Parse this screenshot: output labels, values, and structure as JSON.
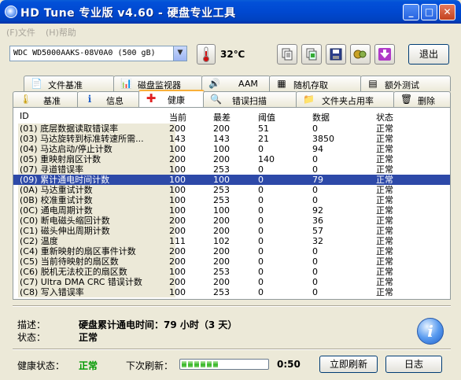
{
  "window": {
    "title": "HD Tune 专业版 v4.60 - 硬盘专业工具"
  },
  "menu": [
    "(F)文件",
    "(H)帮助"
  ],
  "toolbar": {
    "drive": "WDC WD5000AAKS-08V0A0 (500 gB)",
    "temperature": "32℃",
    "exit_label": "退出"
  },
  "tabs_top": [
    {
      "label": "文件基准",
      "icon": "file-benchmark-icon"
    },
    {
      "label": "磁盘监视器",
      "icon": "disk-monitor-icon"
    },
    {
      "label": "AAM",
      "icon": "speaker-icon"
    },
    {
      "label": "随机存取",
      "icon": "random-access-icon"
    },
    {
      "label": "额外测试",
      "icon": "extra-tests-icon"
    }
  ],
  "tabs_bottom": [
    {
      "label": "基准",
      "icon": "benchmark-icon"
    },
    {
      "label": "信息",
      "icon": "info-icon"
    },
    {
      "label": "健康",
      "icon": "health-icon",
      "active": true
    },
    {
      "label": "错误扫描",
      "icon": "error-scan-icon"
    },
    {
      "label": "文件夹占用率",
      "icon": "folder-usage-icon"
    },
    {
      "label": "删除",
      "icon": "erase-icon"
    }
  ],
  "table": {
    "headers": {
      "id": "ID",
      "current": "当前",
      "worst": "最差",
      "threshold": "阈值",
      "data": "数据",
      "status": "状态"
    },
    "rows": [
      {
        "id": "(01) 底层数据读取错误率",
        "current": "200",
        "worst": "200",
        "threshold": "51",
        "data": "0",
        "status": "正常"
      },
      {
        "id": "(03) 马达旋转到标准转速所需...",
        "current": "143",
        "worst": "143",
        "threshold": "21",
        "data": "3850",
        "status": "正常"
      },
      {
        "id": "(04) 马达启动/停止计数",
        "current": "100",
        "worst": "100",
        "threshold": "0",
        "data": "94",
        "status": "正常"
      },
      {
        "id": "(05) 重映射扇区计数",
        "current": "200",
        "worst": "200",
        "threshold": "140",
        "data": "0",
        "status": "正常"
      },
      {
        "id": "(07) 寻道错误率",
        "current": "100",
        "worst": "253",
        "threshold": "0",
        "data": "0",
        "status": "正常"
      },
      {
        "id": "(09) 累计通电时间计数",
        "current": "100",
        "worst": "100",
        "threshold": "0",
        "data": "79",
        "status": "正常",
        "selected": true
      },
      {
        "id": "(0A) 马达重试计数",
        "current": "100",
        "worst": "253",
        "threshold": "0",
        "data": "0",
        "status": "正常"
      },
      {
        "id": "(0B) 校准重试计数",
        "current": "100",
        "worst": "253",
        "threshold": "0",
        "data": "0",
        "status": "正常"
      },
      {
        "id": "(0C) 通电周期计数",
        "current": "100",
        "worst": "100",
        "threshold": "0",
        "data": "92",
        "status": "正常"
      },
      {
        "id": "(C0) 断电磁头缩回计数",
        "current": "200",
        "worst": "200",
        "threshold": "0",
        "data": "36",
        "status": "正常"
      },
      {
        "id": "(C1) 磁头伸出周期计数",
        "current": "200",
        "worst": "200",
        "threshold": "0",
        "data": "57",
        "status": "正常"
      },
      {
        "id": "(C2) 温度",
        "current": "111",
        "worst": "102",
        "threshold": "0",
        "data": "32",
        "status": "正常"
      },
      {
        "id": "(C4) 重新映射的扇区事件计数",
        "current": "200",
        "worst": "200",
        "threshold": "0",
        "data": "0",
        "status": "正常"
      },
      {
        "id": "(C5) 当前待映射的扇区数",
        "current": "200",
        "worst": "200",
        "threshold": "0",
        "data": "0",
        "status": "正常"
      },
      {
        "id": "(C6) 脱机无法校正的扇区数",
        "current": "100",
        "worst": "253",
        "threshold": "0",
        "data": "0",
        "status": "正常"
      },
      {
        "id": "(C7) Ultra DMA CRC 错误计数",
        "current": "200",
        "worst": "200",
        "threshold": "0",
        "data": "0",
        "status": "正常"
      },
      {
        "id": "(C8) 写入错误率",
        "current": "100",
        "worst": "253",
        "threshold": "0",
        "data": "0",
        "status": "正常"
      }
    ]
  },
  "details": {
    "desc_label": "描述：",
    "desc_value": "硬盘累计通电时间：79 小时（3 天）",
    "status_label": "状态：",
    "status_value": "正常"
  },
  "statusbar": {
    "health_label": "健康状态：",
    "health_value": "正常",
    "health_color": "#009900",
    "next_refresh_label": "下次刷新：",
    "refresh_progress": 0.45,
    "timer": "0:50",
    "refresh_button": "立即刷新",
    "log_button": "日志"
  }
}
